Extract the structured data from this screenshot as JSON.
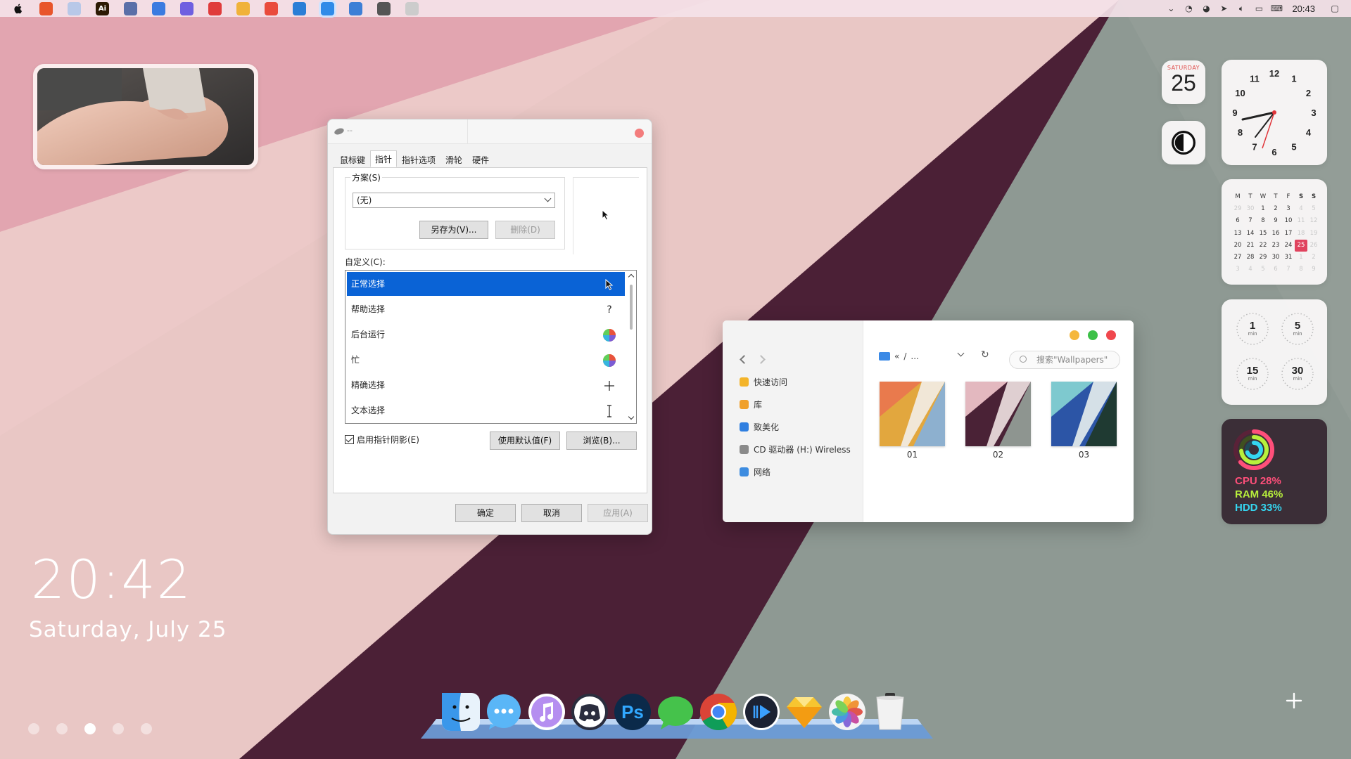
{
  "menubar": {
    "apps": [
      {
        "name": "office",
        "color": "#e8552b",
        "glyph": ""
      },
      {
        "name": "paint-app",
        "color": "#b8c8e8",
        "glyph": ""
      },
      {
        "name": "illustrator",
        "color": "#2c1a04",
        "glyph": "Ai"
      },
      {
        "name": "terminal",
        "color": "#5a6fa8",
        "glyph": ""
      },
      {
        "name": "notes",
        "color": "#3b7be0",
        "glyph": ""
      },
      {
        "name": "telegram-send",
        "color": "#6f5fe0",
        "glyph": ""
      },
      {
        "name": "netease-music",
        "color": "#e03b3b",
        "glyph": ""
      },
      {
        "name": "file-manager",
        "color": "#f0b23a",
        "glyph": ""
      },
      {
        "name": "chrome",
        "color": "#e94b3c",
        "glyph": ""
      },
      {
        "name": "paint",
        "color": "#2a7ed6",
        "glyph": ""
      },
      {
        "name": "app-store",
        "color": "#2f8be8",
        "glyph": ""
      },
      {
        "name": "windows-app",
        "color": "#3d7fd6",
        "glyph": ""
      },
      {
        "name": "attachment",
        "color": "#555555",
        "glyph": ""
      },
      {
        "name": "small-app",
        "color": "#cccccc",
        "glyph": ""
      }
    ],
    "tray_time": "20:43"
  },
  "lockscreen": {
    "time": "20:42",
    "date": "Saturday, July 25"
  },
  "mouse_dialog": {
    "title": "--",
    "tabs": [
      "鼠标键",
      "指针",
      "指针选项",
      "滑轮",
      "硬件"
    ],
    "active_tab": "指针",
    "scheme_label": "方案(S)",
    "scheme_value": "(无)",
    "save_as": "另存为(V)...",
    "delete": "删除(D)",
    "custom_label": "自定义(C):",
    "cursors": [
      {
        "label": "正常选择",
        "cursor": "arrow"
      },
      {
        "label": "帮助选择",
        "cursor": "?"
      },
      {
        "label": "后台运行",
        "cursor": "wheel"
      },
      {
        "label": "忙",
        "cursor": "wheel"
      },
      {
        "label": "精确选择",
        "cursor": "+"
      },
      {
        "label": "文本选择",
        "cursor": "I"
      }
    ],
    "shadow_label": "启用指针阴影(E)",
    "use_default": "使用默认值(F)",
    "browse": "浏览(B)...",
    "ok": "确定",
    "cancel": "取消",
    "apply": "应用(A)"
  },
  "explorer": {
    "sidebar": [
      "快速访问",
      "库",
      "致美化",
      "CD 驱动器 (H:) Wireless",
      "网络"
    ],
    "breadcrumb_prefix": "«",
    "breadcrumb_sep": "/",
    "breadcrumb_more": "...",
    "search_placeholder": "搜索\"Wallpapers\"",
    "files": [
      {
        "name": "01",
        "colors": [
          "#e97a4d",
          "#e2a73e",
          "#8db0cf",
          "#f3eee8"
        ]
      },
      {
        "name": "02",
        "colors": [
          "#e3b8bf",
          "#4a2236",
          "#8e9590",
          "#efe2e2"
        ]
      },
      {
        "name": "03",
        "colors": [
          "#7ec9cf",
          "#2c55a6",
          "#1f3a32",
          "#e8efee"
        ]
      }
    ]
  },
  "widgets": {
    "date_dow": "SATURDAY",
    "date_num": "25",
    "clock_numbers": [
      "12",
      "1",
      "2",
      "3",
      "4",
      "5",
      "6",
      "7",
      "8",
      "9",
      "10",
      "11"
    ],
    "calendar": {
      "headers": [
        "M",
        "T",
        "W",
        "T",
        "F",
        "S",
        "S"
      ],
      "weeks": [
        [
          {
            "d": "29",
            "dim": true
          },
          {
            "d": "30",
            "dim": true
          },
          {
            "d": "1"
          },
          {
            "d": "2"
          },
          {
            "d": "3"
          },
          {
            "d": "4",
            "dim": true
          },
          {
            "d": "5",
            "dim": true
          }
        ],
        [
          {
            "d": "6"
          },
          {
            "d": "7"
          },
          {
            "d": "8"
          },
          {
            "d": "9"
          },
          {
            "d": "10"
          },
          {
            "d": "11",
            "dim": true
          },
          {
            "d": "12",
            "dim": true
          }
        ],
        [
          {
            "d": "13"
          },
          {
            "d": "14"
          },
          {
            "d": "15"
          },
          {
            "d": "16"
          },
          {
            "d": "17"
          },
          {
            "d": "18",
            "dim": true
          },
          {
            "d": "19",
            "dim": true
          }
        ],
        [
          {
            "d": "20"
          },
          {
            "d": "21"
          },
          {
            "d": "22"
          },
          {
            "d": "23"
          },
          {
            "d": "24"
          },
          {
            "d": "25",
            "today": true
          },
          {
            "d": "26",
            "dim": true
          }
        ],
        [
          {
            "d": "27"
          },
          {
            "d": "28"
          },
          {
            "d": "29"
          },
          {
            "d": "30"
          },
          {
            "d": "31"
          },
          {
            "d": "1",
            "dim": true
          },
          {
            "d": "2",
            "dim": true
          }
        ],
        [
          {
            "d": "3",
            "dim": true
          },
          {
            "d": "4",
            "dim": true
          },
          {
            "d": "5",
            "dim": true
          },
          {
            "d": "6",
            "dim": true
          },
          {
            "d": "7",
            "dim": true
          },
          {
            "d": "8",
            "dim": true
          },
          {
            "d": "9",
            "dim": true
          }
        ]
      ]
    },
    "timers": [
      {
        "n": "1",
        "u": "min"
      },
      {
        "n": "5",
        "u": "min"
      },
      {
        "n": "15",
        "u": "min"
      },
      {
        "n": "30",
        "u": "min"
      }
    ],
    "stats": [
      {
        "label": "CPU 28%",
        "color": "#ff4f7a"
      },
      {
        "label": "RAM 46%",
        "color": "#b8f03c"
      },
      {
        "label": "HDD 33%",
        "color": "#35d6f0"
      }
    ]
  },
  "dock": [
    {
      "name": "finder",
      "color": "#4aa3ef"
    },
    {
      "name": "messages",
      "color": "#5ab6f7"
    },
    {
      "name": "itunes",
      "color": "#b58ef0"
    },
    {
      "name": "discord",
      "color": "#2a2d3e"
    },
    {
      "name": "photoshop",
      "color": "#0b2a4a"
    },
    {
      "name": "wechat",
      "color": "#45c24b"
    },
    {
      "name": "chrome",
      "color": "#ffffff"
    },
    {
      "name": "media-player",
      "color": "#1c2233"
    },
    {
      "name": "sketch",
      "color": "#f7c530"
    },
    {
      "name": "photos",
      "color": "#f4f4f4"
    },
    {
      "name": "trash",
      "color": "#f2f2f2"
    }
  ]
}
